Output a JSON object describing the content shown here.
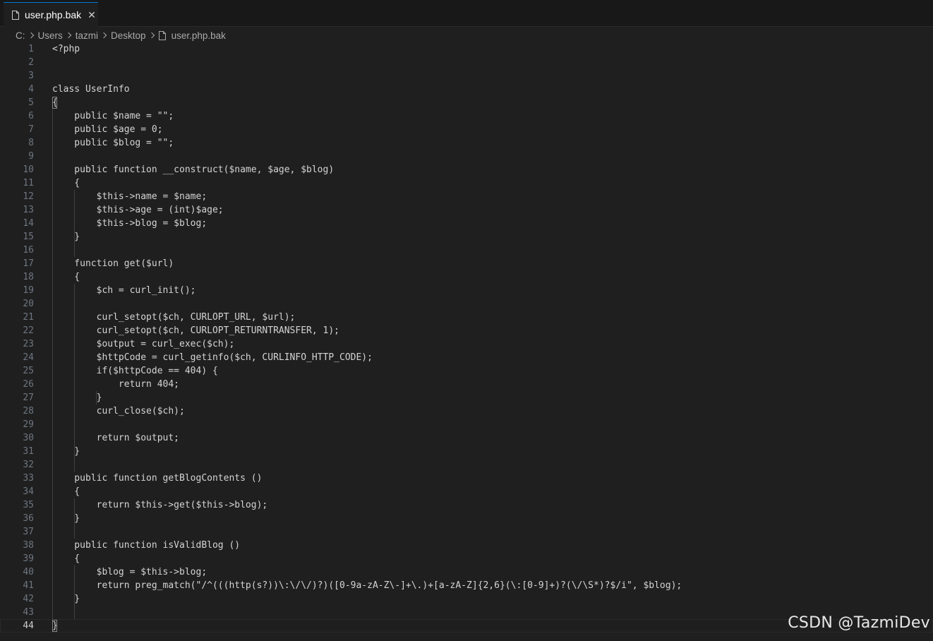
{
  "tab": {
    "title": "user.php.bak",
    "file_icon": "file-icon",
    "close_icon": "close-icon"
  },
  "breadcrumb": {
    "items": [
      "C:",
      "Users",
      "tazmi",
      "Desktop",
      "user.php.bak"
    ],
    "separator_icon": "chevron-right-icon"
  },
  "editor": {
    "current_line": 44,
    "lines": [
      {
        "n": "1",
        "text": "<?php"
      },
      {
        "n": "2",
        "text": ""
      },
      {
        "n": "3",
        "text": ""
      },
      {
        "n": "4",
        "text": "class UserInfo"
      },
      {
        "n": "5",
        "text": "{"
      },
      {
        "n": "6",
        "text": "    public $name = \"\";"
      },
      {
        "n": "7",
        "text": "    public $age = 0;"
      },
      {
        "n": "8",
        "text": "    public $blog = \"\";"
      },
      {
        "n": "9",
        "text": ""
      },
      {
        "n": "10",
        "text": "    public function __construct($name, $age, $blog)"
      },
      {
        "n": "11",
        "text": "    {"
      },
      {
        "n": "12",
        "text": "        $this->name = $name;"
      },
      {
        "n": "13",
        "text": "        $this->age = (int)$age;"
      },
      {
        "n": "14",
        "text": "        $this->blog = $blog;"
      },
      {
        "n": "15",
        "text": "    }"
      },
      {
        "n": "16",
        "text": ""
      },
      {
        "n": "17",
        "text": "    function get($url)"
      },
      {
        "n": "18",
        "text": "    {"
      },
      {
        "n": "19",
        "text": "        $ch = curl_init();"
      },
      {
        "n": "20",
        "text": ""
      },
      {
        "n": "21",
        "text": "        curl_setopt($ch, CURLOPT_URL, $url);"
      },
      {
        "n": "22",
        "text": "        curl_setopt($ch, CURLOPT_RETURNTRANSFER, 1);"
      },
      {
        "n": "23",
        "text": "        $output = curl_exec($ch);"
      },
      {
        "n": "24",
        "text": "        $httpCode = curl_getinfo($ch, CURLINFO_HTTP_CODE);"
      },
      {
        "n": "25",
        "text": "        if($httpCode == 404) {"
      },
      {
        "n": "26",
        "text": "            return 404;"
      },
      {
        "n": "27",
        "text": "        }"
      },
      {
        "n": "28",
        "text": "        curl_close($ch);"
      },
      {
        "n": "29",
        "text": ""
      },
      {
        "n": "30",
        "text": "        return $output;"
      },
      {
        "n": "31",
        "text": "    }"
      },
      {
        "n": "32",
        "text": ""
      },
      {
        "n": "33",
        "text": "    public function getBlogContents ()"
      },
      {
        "n": "34",
        "text": "    {"
      },
      {
        "n": "35",
        "text": "        return $this->get($this->blog);"
      },
      {
        "n": "36",
        "text": "    }"
      },
      {
        "n": "37",
        "text": ""
      },
      {
        "n": "38",
        "text": "    public function isValidBlog ()"
      },
      {
        "n": "39",
        "text": "    {"
      },
      {
        "n": "40",
        "text": "        $blog = $this->blog;"
      },
      {
        "n": "41",
        "text": "        return preg_match(\"/^(((http(s?))\\:\\/\\/)?)([0-9a-zA-Z\\-]+\\.)+[a-zA-Z]{2,6}(\\:[0-9]+)?(\\/\\S*)?$/i\", $blog);"
      },
      {
        "n": "42",
        "text": "    }"
      },
      {
        "n": "43",
        "text": ""
      },
      {
        "n": "44",
        "text": "}"
      }
    ]
  },
  "watermark": "CSDN @TazmiDev",
  "colors": {
    "editor_bg": "#1f1f1f",
    "tabbar_bg": "#181818",
    "accent": "#0078d4",
    "text": "#d4d4d4",
    "line_number": "#6e7681"
  }
}
